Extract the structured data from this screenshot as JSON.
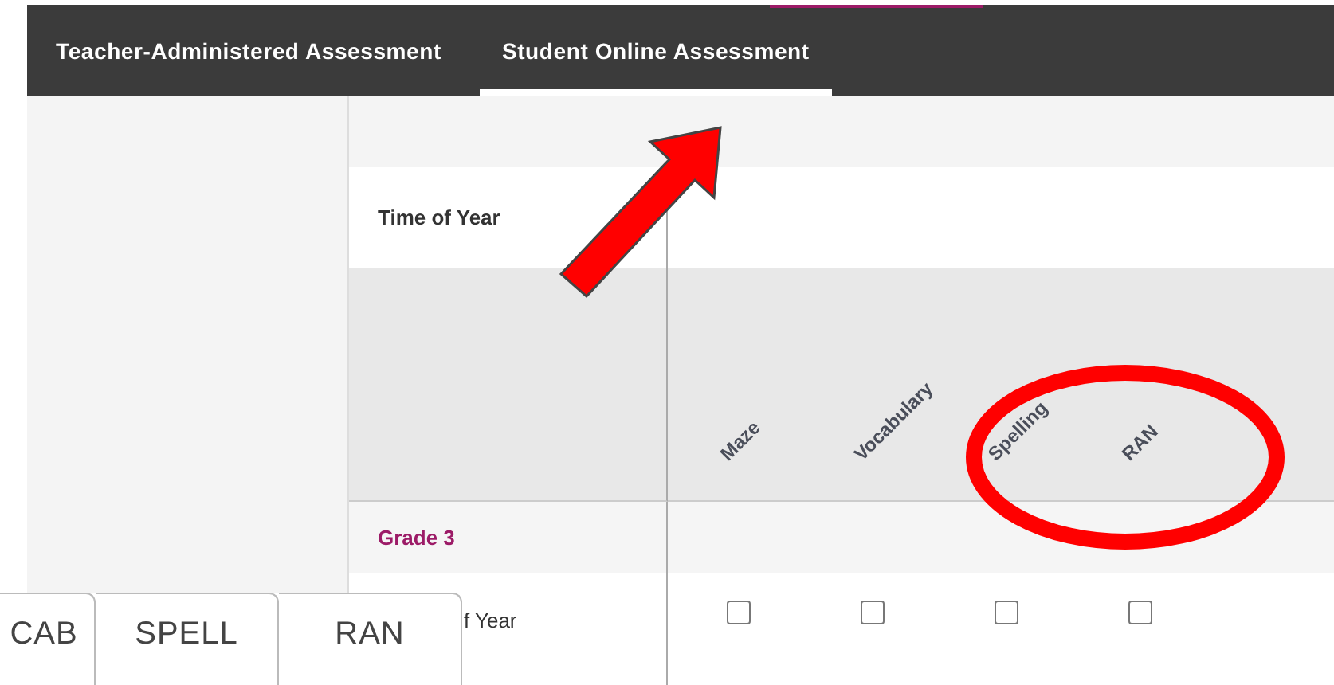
{
  "tabs": [
    {
      "label": "Teacher-Administered Assessment",
      "selected": false
    },
    {
      "label": "Student Online Assessment",
      "selected": true
    }
  ],
  "table": {
    "header": "Time of Year",
    "columns": [
      "Maze",
      "Vocabulary",
      "Spelling",
      "RAN"
    ],
    "group": "Grade 3",
    "row": {
      "label": "f Year",
      "checks": [
        {
          "checked": false
        },
        {
          "checked": false
        },
        {
          "checked": false
        },
        {
          "checked": false
        }
      ]
    }
  },
  "inset_tabs": [
    "CAB",
    "SPELL",
    "RAN"
  ]
}
